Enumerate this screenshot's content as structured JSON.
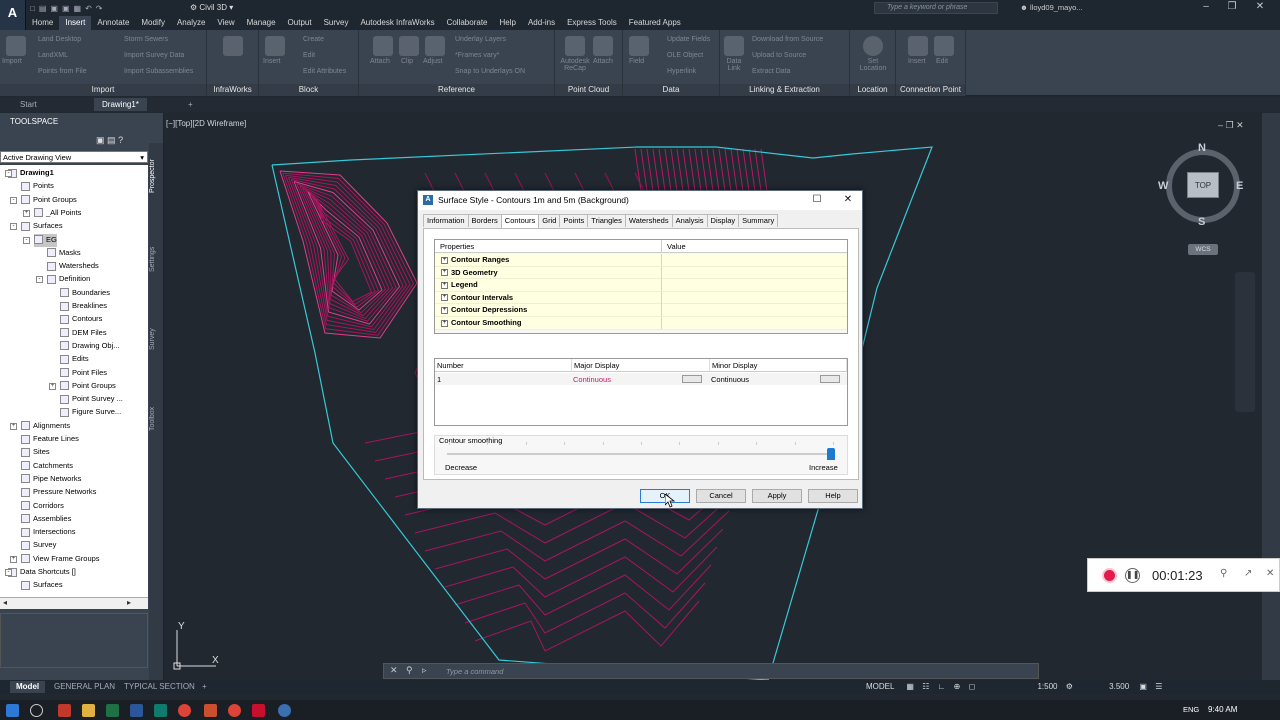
{
  "app": {
    "badge": "A",
    "sub": "C3D",
    "title": "Civil 3D",
    "search_placeholder": "Type a keyword or phrase",
    "user": "lloyd09_mayo..."
  },
  "menu_tabs": [
    "Home",
    "Insert",
    "Annotate",
    "Modify",
    "Analyze",
    "View",
    "Manage",
    "Output",
    "Survey",
    "Autodesk InfraWorks",
    "Collaborate",
    "Help",
    "Add-ins",
    "Express Tools",
    "Featured Apps"
  ],
  "active_menu_tab": "Insert",
  "ribbon": {
    "import": {
      "label": "Import",
      "big": "Import",
      "items": [
        "Land Desktop",
        "LandXML",
        "Points from File",
        "Storm Sewers",
        "Import Survey Data",
        "Import Subassemblies"
      ]
    },
    "infraworks": {
      "label": "InfraWorks"
    },
    "block": {
      "label": "Block",
      "big": "Insert",
      "items": [
        "Create",
        "Edit",
        "Edit Attributes"
      ]
    },
    "reference": {
      "label": "Reference",
      "big": [
        "Attach",
        "Clip",
        "Adjust"
      ],
      "items": [
        "Underlay Layers",
        "*Frames vary*",
        "Snap to Underlays ON"
      ]
    },
    "pointcloud": {
      "label": "Point Cloud",
      "big": [
        "Autodesk ReCap",
        "Attach"
      ]
    },
    "data": {
      "label": "Data",
      "big": [
        "Field",
        "Data Link"
      ],
      "items": [
        "Update Fields",
        "OLE Object",
        "Hyperlink"
      ]
    },
    "linking": {
      "label": "Linking & Extraction",
      "items": [
        "Download from Source",
        "Upload to Source",
        "Extract Data"
      ]
    },
    "location": {
      "label": "Location",
      "big": "Set Location"
    },
    "connection": {
      "label": "Connection Point",
      "big": [
        "Insert",
        "Edit"
      ]
    }
  },
  "doc_tabs": [
    "Start",
    "Drawing1*"
  ],
  "toolspace": {
    "title": "TOOLSPACE",
    "view": "Active Drawing View",
    "side_tabs": [
      "Prospector",
      "Settings",
      "Survey",
      "Toolbox"
    ],
    "tree": [
      {
        "label": "Drawing1",
        "indent": 0,
        "bold": true
      },
      {
        "label": "Points",
        "indent": 1
      },
      {
        "label": "Point Groups",
        "indent": 1
      },
      {
        "label": "_All Points",
        "indent": 2
      },
      {
        "label": "Surfaces",
        "indent": 1
      },
      {
        "label": "EG",
        "indent": 2,
        "sel": true
      },
      {
        "label": "Masks",
        "indent": 3
      },
      {
        "label": "Watersheds",
        "indent": 3
      },
      {
        "label": "Definition",
        "indent": 3
      },
      {
        "label": "Boundaries",
        "indent": 4
      },
      {
        "label": "Breaklines",
        "indent": 4
      },
      {
        "label": "Contours",
        "indent": 4
      },
      {
        "label": "DEM Files",
        "indent": 4
      },
      {
        "label": "Drawing Obj...",
        "indent": 4
      },
      {
        "label": "Edits",
        "indent": 4
      },
      {
        "label": "Point Files",
        "indent": 4
      },
      {
        "label": "Point Groups",
        "indent": 4
      },
      {
        "label": "Point Survey ...",
        "indent": 4
      },
      {
        "label": "Figure Surve...",
        "indent": 4
      },
      {
        "label": "Alignments",
        "indent": 1
      },
      {
        "label": "Feature Lines",
        "indent": 1
      },
      {
        "label": "Sites",
        "indent": 1
      },
      {
        "label": "Catchments",
        "indent": 1
      },
      {
        "label": "Pipe Networks",
        "indent": 1
      },
      {
        "label": "Pressure Networks",
        "indent": 1
      },
      {
        "label": "Corridors",
        "indent": 1
      },
      {
        "label": "Assemblies",
        "indent": 1
      },
      {
        "label": "Intersections",
        "indent": 1
      },
      {
        "label": "Survey",
        "indent": 1
      },
      {
        "label": "View Frame Groups",
        "indent": 1
      },
      {
        "label": "Data Shortcuts []",
        "indent": 0
      },
      {
        "label": "Surfaces",
        "indent": 1
      }
    ]
  },
  "viewport": {
    "label": "[−][Top][2D Wireframe]",
    "cube_top": "TOP",
    "compass": {
      "n": "N",
      "s": "S",
      "e": "E",
      "w": "W"
    },
    "wcs": "WCS",
    "ucs_x": "X",
    "ucs_y": "Y"
  },
  "dialog": {
    "title": "Surface Style - Contours 1m and 5m (Background)",
    "tabs": [
      "Information",
      "Borders",
      "Contours",
      "Grid",
      "Points",
      "Triangles",
      "Watersheds",
      "Analysis",
      "Display",
      "Summary"
    ],
    "active_tab": "Contours",
    "prop_headers": {
      "properties": "Properties",
      "value": "Value"
    },
    "prop_rows": [
      "Contour Ranges",
      "3D Geometry",
      "Legend",
      "Contour Intervals",
      "Contour Depressions",
      "Contour Smoothing"
    ],
    "display_headers": {
      "number": "Number",
      "major": "Major Display",
      "minor": "Minor Display"
    },
    "display_row": {
      "number": "1",
      "major": "Continuous",
      "minor": "Continuous"
    },
    "smoothing": {
      "label": "Contour smoothing",
      "decrease": "Decrease",
      "increase": "Increase",
      "value": 1.0
    },
    "buttons": {
      "ok": "OK",
      "cancel": "Cancel",
      "apply": "Apply",
      "help": "Help"
    }
  },
  "command": {
    "placeholder": "Type a command"
  },
  "recorder": {
    "time": "00:01:23"
  },
  "layout_tabs": [
    "Model",
    "GENERAL PLAN",
    "TYPICAL SECTION"
  ],
  "status": {
    "model": "MODEL",
    "scale": "1:500",
    "value": "3.500"
  },
  "taskbar": {
    "lang": "ENG",
    "time": "9:40 AM"
  },
  "colors": {
    "accent": "#1c7ad1",
    "contour": "#c8196e",
    "border": "#38c8d8",
    "major": "#c8196e"
  }
}
